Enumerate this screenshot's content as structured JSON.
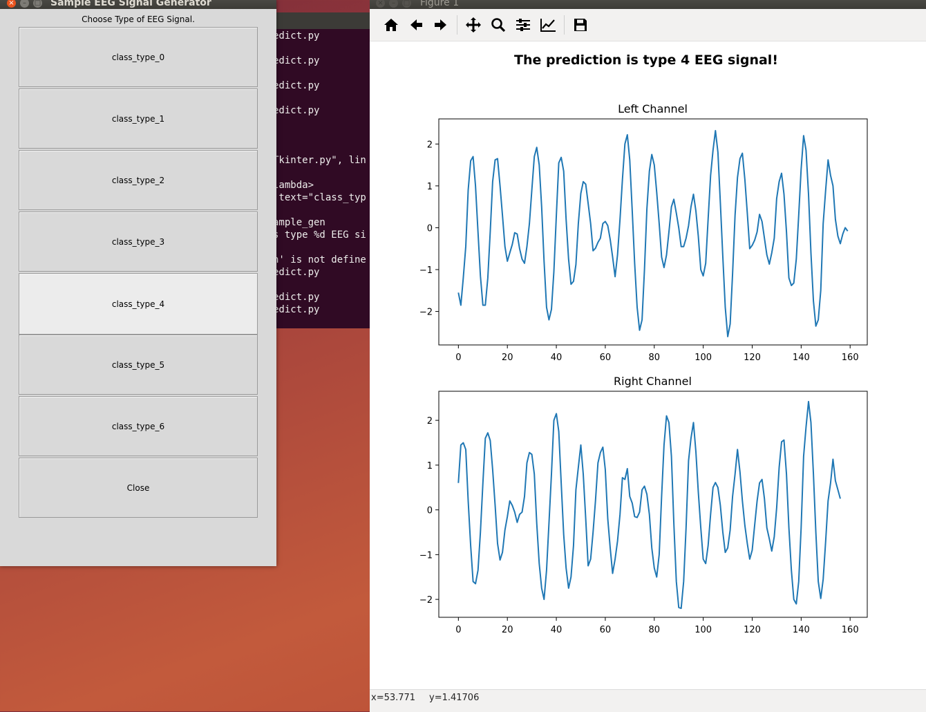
{
  "terminal": {
    "lines": [
      "edict.py",
      "",
      "edict.py",
      "",
      "edict.py",
      "",
      "edict.py",
      "",
      "",
      "",
      "Tkinter.py\", lin",
      "",
      "lambda>",
      " text=\"class_typ",
      "",
      "ample_gen",
      "s type %d EEG si",
      "",
      "n' is not define",
      "edict.py",
      "",
      "edict.py",
      "edict.py"
    ]
  },
  "tk_window": {
    "title": "Sample EEG Signal Generator",
    "prompt": "Choose Type of EEG Signal.",
    "buttons": [
      "class_type_0",
      "class_type_1",
      "class_type_2",
      "class_type_3",
      "class_type_4",
      "class_type_5",
      "class_type_6",
      "Close"
    ],
    "active_button": "class_type_4"
  },
  "figure_window": {
    "title": "Figure 1",
    "toolbar": [
      "home-icon",
      "back-icon",
      "forward-icon",
      "pan-icon",
      "zoom-icon",
      "configure-subplots-icon",
      "edit-axis-icon",
      "save-icon"
    ],
    "status": {
      "x": "x=53.771",
      "y": "y=1.41706"
    }
  },
  "colors": {
    "line": "#1f77b4",
    "tk_bg": "#d9d9d9",
    "active": "#ececec",
    "close": "#e9541f"
  },
  "chart_data": {
    "type": "line",
    "title": "The prediction is type 4 EEG signal!",
    "charts": [
      {
        "title": "Left Channel",
        "x_ticks": [
          0,
          20,
          40,
          60,
          80,
          100,
          120,
          140,
          160
        ],
        "y_ticks": [
          -2,
          -1,
          0,
          1,
          2
        ],
        "xlim": [
          -8,
          167
        ],
        "ylim": [
          -2.8,
          2.6
        ],
        "values": [
          -1.55,
          -1.85,
          -1.2,
          -0.45,
          0.9,
          1.6,
          1.7,
          1.0,
          -0.1,
          -1.15,
          -1.85,
          -1.85,
          -1.2,
          -0.1,
          1.1,
          1.62,
          1.65,
          1.0,
          0.3,
          -0.45,
          -0.8,
          -0.6,
          -0.4,
          -0.12,
          -0.15,
          -0.5,
          -0.75,
          -0.85,
          -0.45,
          0.1,
          0.9,
          1.7,
          1.92,
          1.5,
          0.5,
          -0.8,
          -1.9,
          -2.2,
          -1.95,
          -1.05,
          0.3,
          1.55,
          1.68,
          1.35,
          0.2,
          -0.75,
          -1.35,
          -1.28,
          -0.88,
          0.1,
          0.82,
          1.1,
          1.04,
          0.58,
          0.1,
          -0.55,
          -0.49,
          -0.35,
          -0.25,
          0.1,
          0.15,
          0.05,
          -0.28,
          -0.7,
          -1.17,
          -0.65,
          0.2,
          1.15,
          2.0,
          2.22,
          1.62,
          0.4,
          -0.85,
          -1.9,
          -2.45,
          -2.2,
          -1.0,
          0.45,
          1.35,
          1.75,
          1.5,
          0.85,
          0.1,
          -0.7,
          -0.95,
          -0.65,
          -0.1,
          0.5,
          0.68,
          0.35,
          0.0,
          -0.45,
          -0.45,
          -0.25,
          0.05,
          0.5,
          0.8,
          0.4,
          -0.2,
          -1.0,
          -1.15,
          -0.85,
          0.2,
          1.25,
          1.85,
          2.32,
          1.8,
          0.6,
          -0.7,
          -1.9,
          -2.6,
          -2.3,
          -1.1,
          0.3,
          1.2,
          1.65,
          1.78,
          1.15,
          0.35,
          -0.5,
          -0.42,
          -0.3,
          -0.1,
          0.32,
          0.15,
          -0.25,
          -0.65,
          -0.87,
          -0.6,
          -0.25,
          0.7,
          1.1,
          1.3,
          0.8,
          -0.1,
          -1.2,
          -1.38,
          -1.32,
          -0.75,
          0.3,
          1.4,
          2.2,
          1.85,
          0.8,
          -0.6,
          -1.75,
          -2.35,
          -2.2,
          -1.5,
          0.1,
          0.9,
          1.62,
          1.25,
          1.0,
          0.2,
          -0.2,
          -0.38,
          -0.15,
          0.0,
          -0.08
        ]
      },
      {
        "title": "Right Channel",
        "x_ticks": [
          0,
          20,
          40,
          60,
          80,
          100,
          120,
          140,
          160
        ],
        "y_ticks": [
          -2,
          -1,
          0,
          1,
          2
        ],
        "xlim": [
          -8,
          167
        ],
        "ylim": [
          -2.4,
          2.65
        ],
        "values": [
          0.6,
          1.45,
          1.5,
          1.35,
          0.2,
          -0.8,
          -1.6,
          -1.65,
          -1.35,
          -0.5,
          0.6,
          1.6,
          1.72,
          1.55,
          0.9,
          0.1,
          -0.75,
          -1.12,
          -0.95,
          -0.45,
          -0.15,
          0.2,
          0.1,
          -0.05,
          -0.28,
          -0.1,
          -0.05,
          0.3,
          1.05,
          1.28,
          1.24,
          0.8,
          -0.3,
          -1.2,
          -1.75,
          -2.0,
          -1.35,
          -0.3,
          0.8,
          2.0,
          2.15,
          1.75,
          0.6,
          -0.55,
          -1.3,
          -1.75,
          -1.5,
          -0.8,
          0.45,
          0.95,
          1.45,
          0.8,
          -0.2,
          -1.25,
          -1.1,
          -0.5,
          0.2,
          1.05,
          1.28,
          1.4,
          0.9,
          -0.2,
          -0.85,
          -1.42,
          -1.1,
          -0.7,
          -0.1,
          0.72,
          0.68,
          0.92,
          0.3,
          0.15,
          -0.15,
          -0.17,
          -0.05,
          0.45,
          0.53,
          0.35,
          -0.1,
          -0.85,
          -1.3,
          -1.5,
          -1.0,
          0.3,
          1.45,
          2.1,
          1.95,
          1.2,
          -0.3,
          -1.6,
          -2.18,
          -2.2,
          -1.6,
          -0.4,
          1.1,
          1.6,
          1.95,
          1.3,
          0.4,
          -0.4,
          -1.1,
          -1.2,
          -0.8,
          -0.1,
          0.5,
          0.61,
          0.5,
          0.1,
          -0.5,
          -0.95,
          -0.85,
          -0.45,
          0.3,
          0.8,
          1.35,
          0.85,
          0.2,
          -0.35,
          -0.75,
          -1.1,
          -0.9,
          -0.35,
          0.2,
          0.6,
          0.68,
          0.25,
          -0.4,
          -0.65,
          -0.92,
          -0.6,
          0.05,
          0.95,
          1.52,
          1.56,
          0.8,
          -0.4,
          -1.35,
          -2.0,
          -2.1,
          -1.6,
          -0.4,
          1.2,
          1.85,
          2.42,
          1.95,
          0.8,
          -0.5,
          -1.6,
          -1.98,
          -1.55,
          -0.7,
          0.2,
          0.6,
          1.13,
          0.65,
          0.45,
          0.25
        ]
      }
    ]
  }
}
